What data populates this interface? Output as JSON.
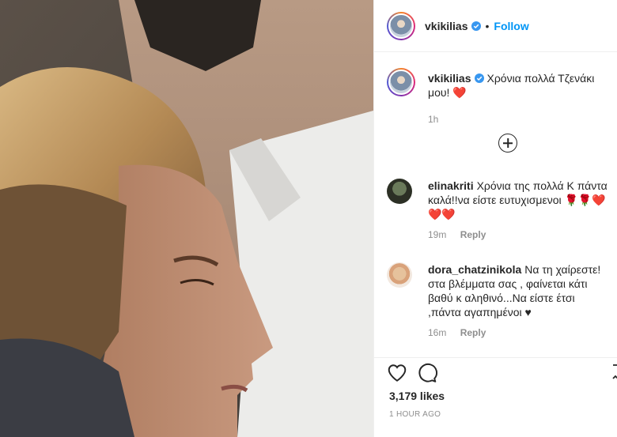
{
  "post": {
    "username": "vkikilias",
    "follow_label": "Follow",
    "separator": "•"
  },
  "caption": {
    "username": "vkikilias",
    "text": "Χρόνια πολλά Τζενάκι μου!",
    "emoji": "❤️",
    "age": "1h"
  },
  "comments": [
    {
      "username": "elinakriti",
      "text": "Χρόνια της πολλά Κ πάντα καλά!!να είστε ευτυχισμενοι",
      "emoji_line1": "🌹🌹❤️",
      "emoji_line2": "❤️❤️",
      "age": "19m",
      "reply_label": "Reply"
    },
    {
      "username": "dora_chatzinikola",
      "text": "Να τη χαίρεστε!στα βλέμματα σας , φαίνεται κάτι βαθύ κ αληθινό...Να είστε έτσι ,πάντα αγαπημένοι ♥",
      "age": "16m",
      "reply_label": "Reply"
    }
  ],
  "footer": {
    "likes": "3,179 likes",
    "timestamp": "1 HOUR AGO"
  },
  "icons": {
    "verified": "verified-badge-icon",
    "like": "heart-outline-icon",
    "comment": "speech-bubble-icon",
    "load_more": "plus-circle-icon"
  },
  "colors": {
    "link_blue": "#0095f6",
    "verified_blue": "#3897f0",
    "heart_red": "#ed4956",
    "meta_gray": "#8e8e8e"
  }
}
